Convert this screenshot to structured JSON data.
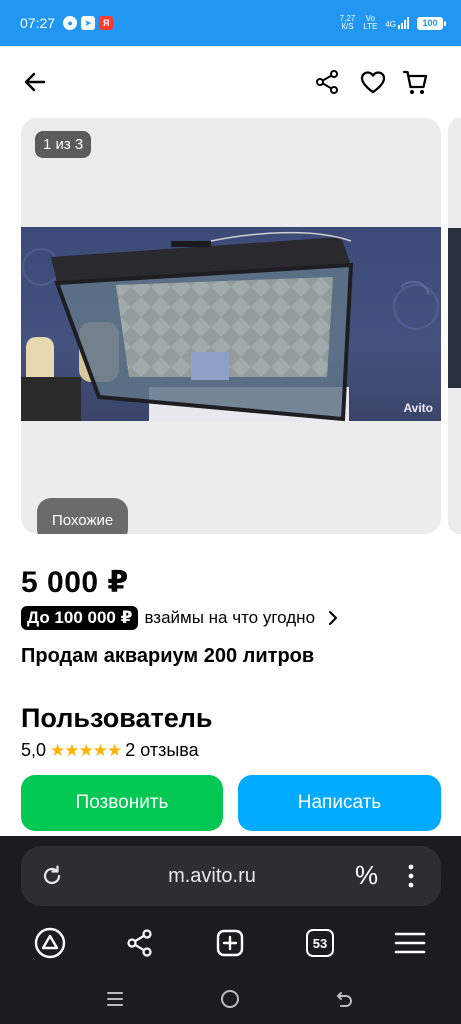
{
  "status_bar": {
    "time": "07:27",
    "notifications": [
      "chat-bubble-icon",
      "telegram-icon",
      "yandex-icon"
    ],
    "net_speed_value": "7,27",
    "net_speed_unit": "К/S",
    "volte_top": "Vo",
    "volte_bottom": "LTE",
    "network_type": "4G",
    "battery": "100",
    "color": "#2196f3"
  },
  "nav": {
    "back_icon": "arrow-left-icon",
    "share_icon": "share-icon",
    "favorite_icon": "heart-outline-icon",
    "cart_icon": "cart-icon"
  },
  "gallery": {
    "counter": "1 из 3",
    "similar_label": "Похожие",
    "watermark": "Avito"
  },
  "listing": {
    "price": "5 000 ₽",
    "credit_badge": "До 100 000 ₽",
    "credit_text": "взаймы на что угодно",
    "credit_chevron": "›",
    "title": "Продам аквариум 200 литров"
  },
  "seller": {
    "name": "Пользователь",
    "rating": "5,0",
    "stars": "★★★★★",
    "reviews": "2 отзыва"
  },
  "actions": {
    "call_label": "Позвонить",
    "write_label": "Написать",
    "call_color": "#00c853",
    "write_color": "#00aaff"
  },
  "browser": {
    "url": "m.avito.ru",
    "percent_label": "%",
    "tabs_count": "53"
  }
}
